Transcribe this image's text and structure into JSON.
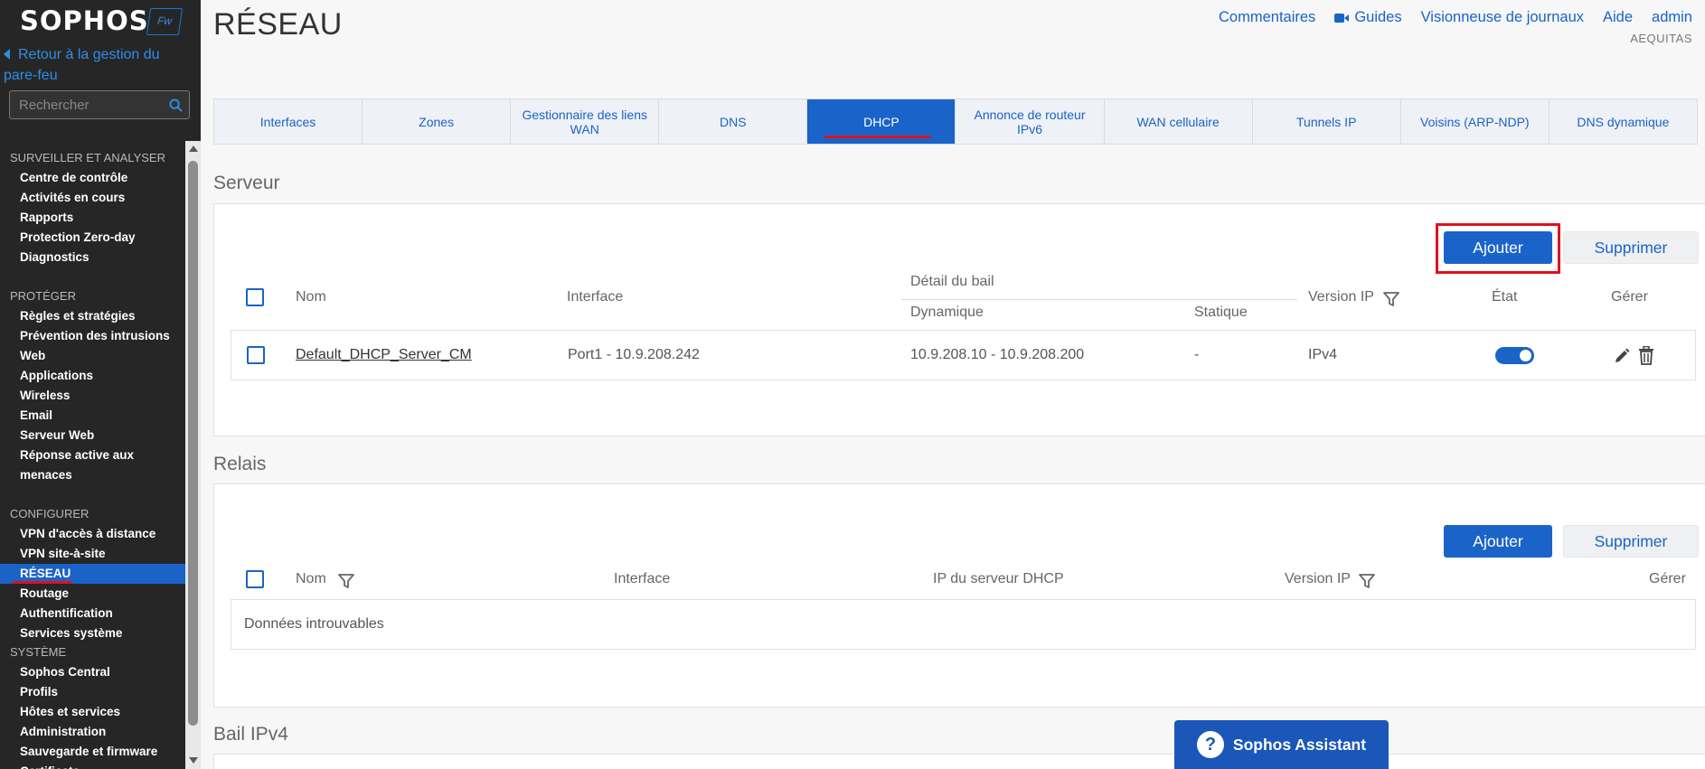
{
  "app": {
    "brand": "SOPHOS",
    "product_badge": "Fw"
  },
  "sidebar": {
    "back_link": "Retour à la gestion du pare-feu",
    "search_placeholder": "Rechercher",
    "sections": [
      {
        "title": "SURVEILLER ET ANALYSER",
        "items": [
          "Centre de contrôle",
          "Activités en cours",
          "Rapports",
          "Protection Zero-day",
          "Diagnostics"
        ]
      },
      {
        "title": "PROTÉGER",
        "items": [
          "Règles et stratégies",
          "Prévention des intrusions",
          "Web",
          "Applications",
          "Wireless",
          "Email",
          "Serveur Web",
          "Réponse active aux menaces"
        ]
      },
      {
        "title": "CONFIGURER",
        "items": [
          "VPN d'accès à distance",
          "VPN site-à-site",
          "RÉSEAU",
          "Routage",
          "Authentification",
          "Services système"
        ]
      },
      {
        "title": "SYSTÈME",
        "items": [
          "Sophos Central",
          "Profils",
          "Hôtes et services",
          "Administration",
          "Sauvegarde et firmware",
          "Certificats"
        ]
      }
    ],
    "active_item": "RÉSEAU"
  },
  "header": {
    "title": "RÉSEAU",
    "links": {
      "feedback": "Commentaires",
      "guides": "Guides",
      "log_viewer": "Visionneuse de journaux",
      "help": "Aide",
      "user": "admin"
    },
    "org": "AEQUITAS"
  },
  "tabs": [
    {
      "label": "Interfaces",
      "active": false
    },
    {
      "label": "Zones",
      "active": false
    },
    {
      "label": "Gestionnaire des liens WAN",
      "active": false
    },
    {
      "label": "DNS",
      "active": false
    },
    {
      "label": "DHCP",
      "active": true
    },
    {
      "label": "Annonce de routeur IPv6",
      "active": false
    },
    {
      "label": "WAN cellulaire",
      "active": false
    },
    {
      "label": "Tunnels IP",
      "active": false
    },
    {
      "label": "Voisins (ARP-NDP)",
      "active": false
    },
    {
      "label": "DNS dynamique",
      "active": false
    }
  ],
  "server": {
    "title": "Serveur",
    "add_label": "Ajouter",
    "delete_label": "Supprimer",
    "columns": {
      "name": "Nom",
      "interface": "Interface",
      "lease_detail": "Détail du bail",
      "dynamic": "Dynamique",
      "static": "Statique",
      "ip_version": "Version IP",
      "state": "État",
      "manage": "Gérer"
    },
    "rows": [
      {
        "name": "Default_DHCP_Server_CM",
        "interface": "Port1 - 10.9.208.242",
        "dynamic": "10.9.208.10 - 10.9.208.200",
        "static": "-",
        "ip_version": "IPv4",
        "enabled": true
      }
    ]
  },
  "relay": {
    "title": "Relais",
    "add_label": "Ajouter",
    "delete_label": "Supprimer",
    "columns": {
      "name": "Nom",
      "interface": "Interface",
      "dhcp_server_ip": "IP du serveur DHCP",
      "ip_version": "Version IP",
      "manage": "Gérer"
    },
    "empty_text": "Données introuvables"
  },
  "lease": {
    "title": "Bail IPv4"
  },
  "assistant": {
    "label": "Sophos Assistant"
  },
  "colors": {
    "brand_blue": "#1a63c9",
    "sidebar_bg": "#262626",
    "highlight_red": "#e0111d"
  }
}
